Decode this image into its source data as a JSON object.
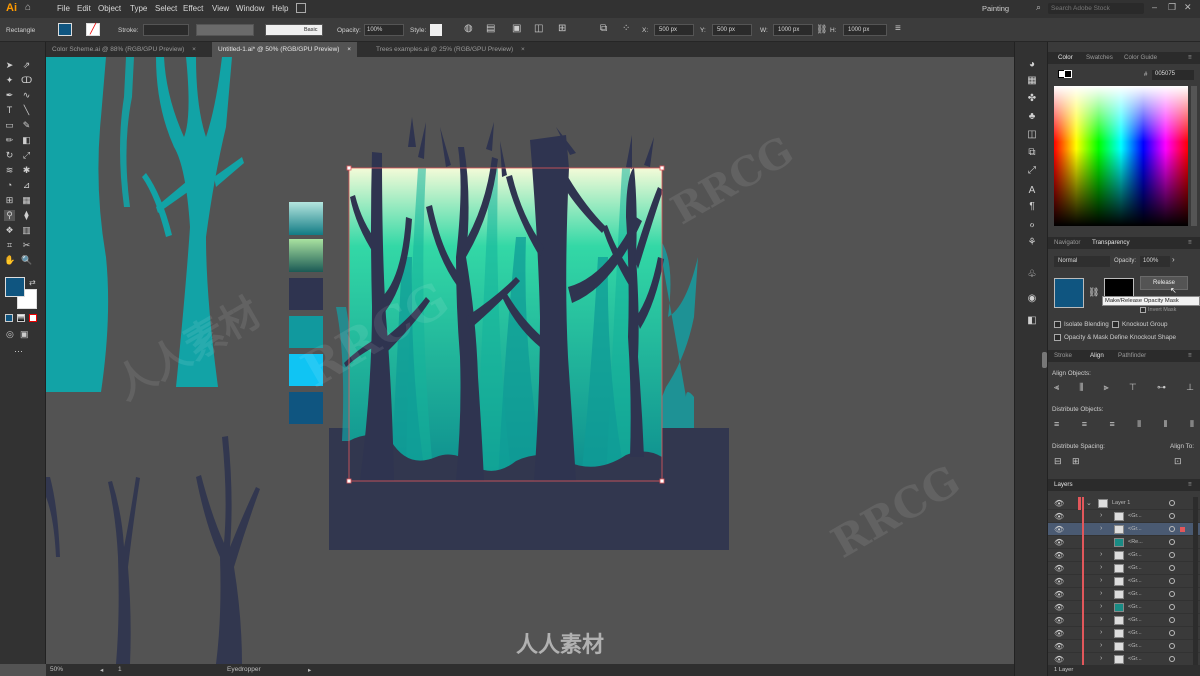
{
  "app": {
    "logo": "Ai",
    "menus": [
      "File",
      "Edit",
      "Object",
      "Type",
      "Select",
      "Effect",
      "View",
      "Window",
      "Help"
    ],
    "workspace": "Painting",
    "search_placeholder": "Search Adobe Stock"
  },
  "control_bar": {
    "tool_name": "Rectangle",
    "stroke_label": "Stroke:",
    "brush_label": "Basic",
    "opacity_label": "Opacity:",
    "opacity_value": "100%",
    "style_label": "Style:",
    "x_label": "X:",
    "x_value": "500 px",
    "y_label": "Y:",
    "y_value": "500 px",
    "w_label": "W:",
    "w_value": "1000 px",
    "h_label": "H:",
    "h_value": "1000 px"
  },
  "tabs": [
    {
      "label": "Color Scheme.ai @ 88% (RGB/GPU Preview)"
    },
    {
      "label": "Untitled-1.ai* @ 50% (RGB/GPU Preview)"
    },
    {
      "label": "Trees examples.ai @ 25% (RGB/GPU Preview)"
    }
  ],
  "status": {
    "zoom": "50%",
    "page": "1",
    "tool": "Eyedropper"
  },
  "swatches": [
    "#7ecdc9",
    "#2e7a5c",
    "#2f3450",
    "#11999e",
    "#10c4f3",
    "#0f5580"
  ],
  "colors": {
    "accent_fill": "#0f5580",
    "selection": "#e2575b",
    "tree_dark": "#2f3450",
    "teal": "#12a3a6",
    "ground": "#32374f"
  },
  "color_panel": {
    "tabs": [
      "Color",
      "Swatches",
      "Color Guide"
    ],
    "hex_value": "005075"
  },
  "transparency_panel": {
    "tabs": [
      "Navigator",
      "Transparency"
    ],
    "blend_mode": "Normal",
    "opacity_label": "Opacity:",
    "opacity_value": "100%",
    "release_button": "Release",
    "tooltip": "Make/Release Opacity Mask",
    "invert_mask": "Invert Mask",
    "isolate_blending": "Isolate Blending",
    "knockout_group": "Knockout Group",
    "opacity_mask_knockout": "Opacity & Mask Define Knockout Shape"
  },
  "align_panel": {
    "tabs": [
      "Stroke",
      "Align",
      "Pathfinder"
    ],
    "align_objects": "Align Objects:",
    "distribute_objects": "Distribute Objects:",
    "distribute_spacing": "Distribute Spacing:",
    "align_to": "Align To:"
  },
  "layers_panel": {
    "title": "Layers",
    "rows": [
      {
        "name": "Layer 1"
      },
      {
        "name": "<Gr..."
      },
      {
        "name": "<Gr..."
      },
      {
        "name": "<Re..."
      },
      {
        "name": "<Gr..."
      },
      {
        "name": "<Gr..."
      },
      {
        "name": "<Gr..."
      },
      {
        "name": "<Gr..."
      },
      {
        "name": "<Gr..."
      },
      {
        "name": "<Gr..."
      },
      {
        "name": "<Gr..."
      },
      {
        "name": "<Gr..."
      },
      {
        "name": "<Gr..."
      }
    ],
    "footer": "1 Layer"
  },
  "watermark": [
    "RRCG",
    "人人素材"
  ]
}
